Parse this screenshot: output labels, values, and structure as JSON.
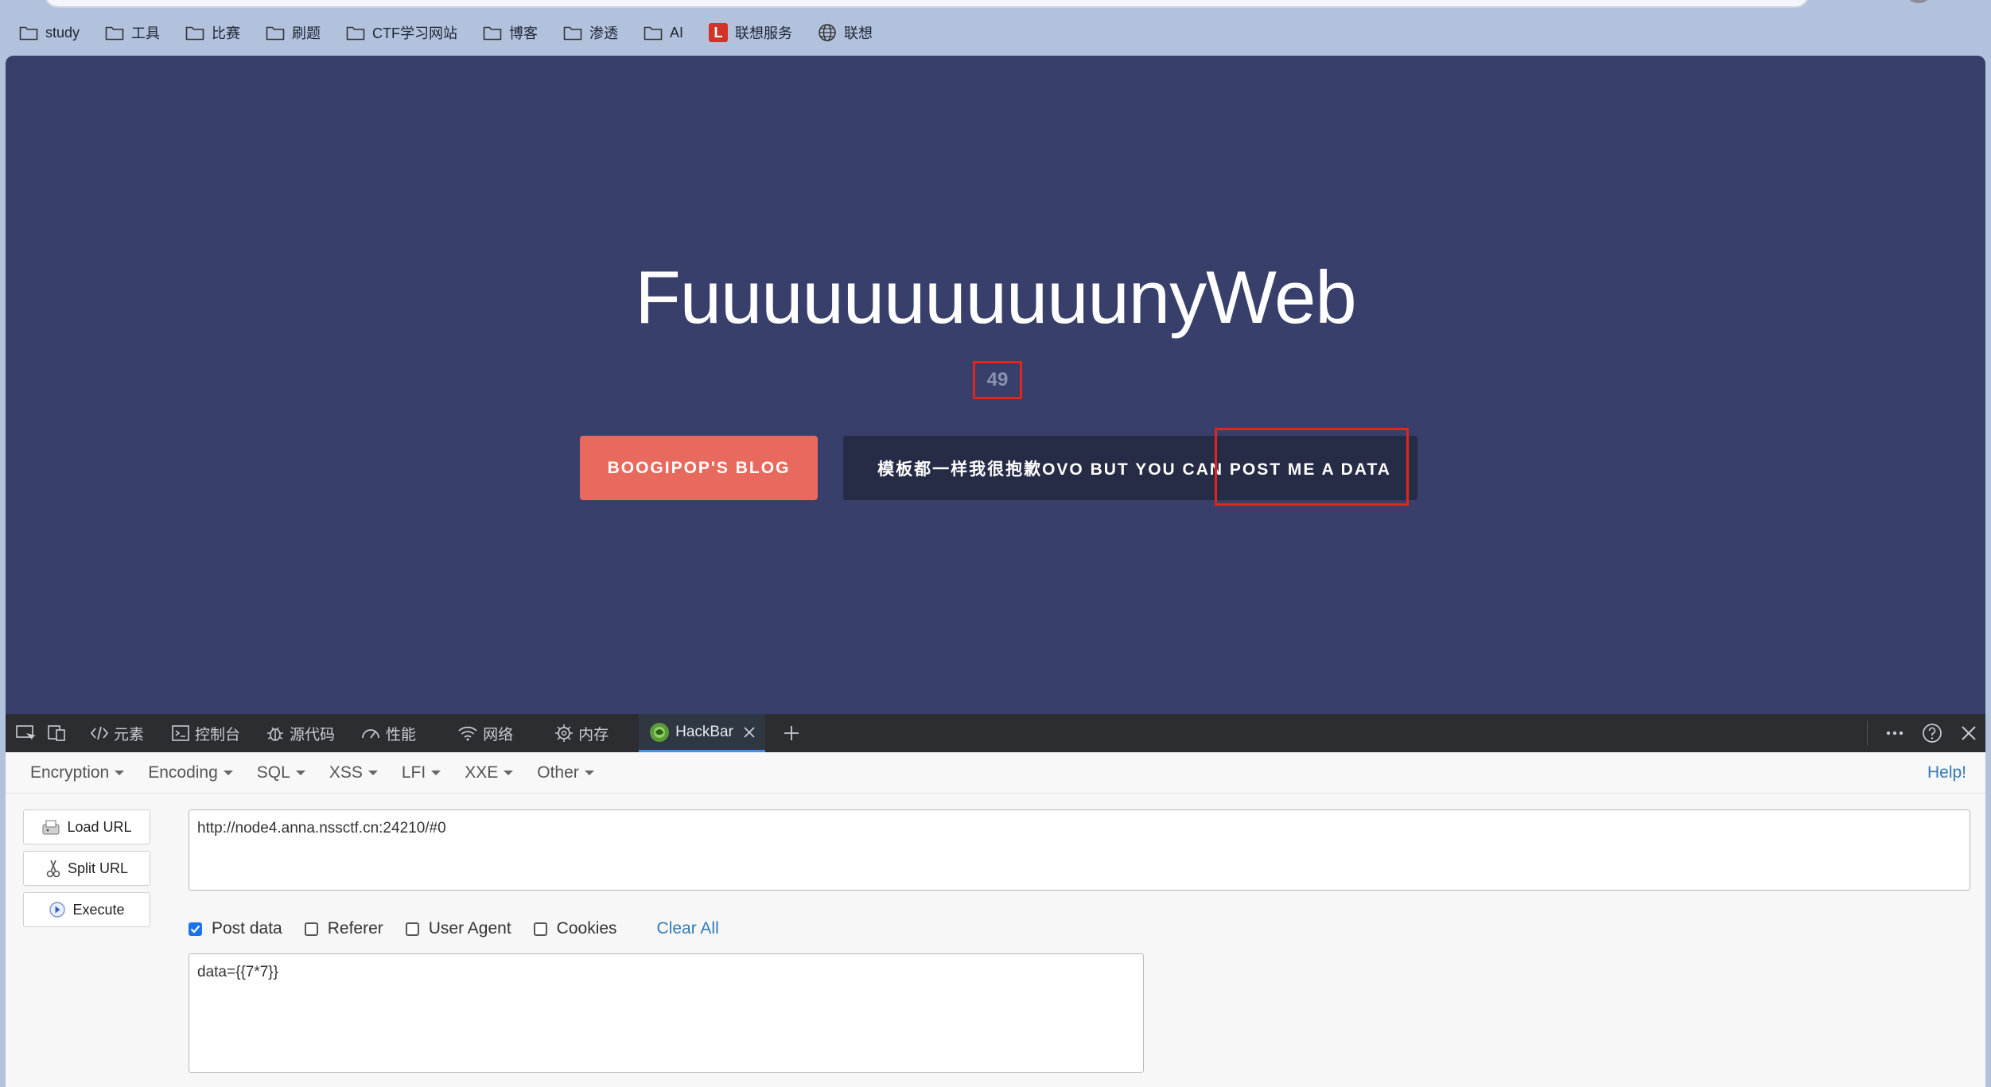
{
  "bookmarks": [
    {
      "label": "study",
      "icon": "folder-icon"
    },
    {
      "label": "工具",
      "icon": "folder-icon"
    },
    {
      "label": "比赛",
      "icon": "folder-icon"
    },
    {
      "label": "刷题",
      "icon": "folder-icon"
    },
    {
      "label": "CTF学习网站",
      "icon": "folder-icon"
    },
    {
      "label": "博客",
      "icon": "folder-icon"
    },
    {
      "label": "渗透",
      "icon": "folder-icon"
    },
    {
      "label": "AI",
      "icon": "folder-icon"
    },
    {
      "label": "联想服务",
      "icon": "lenovo-logo-icon",
      "logo_letter": "L"
    },
    {
      "label": "联想",
      "icon": "globe-icon"
    }
  ],
  "page": {
    "title": "FuuuuuuuuuuunyWeb",
    "result": "49",
    "blog_button": "BOOGIPOP'S BLOG",
    "post_button": "模板都一样我很抱歉OVO BUT YOU CAN POST ME A DATA"
  },
  "devtools": {
    "tabs": [
      {
        "label": "元素",
        "icon": "code-icon"
      },
      {
        "label": "控制台",
        "icon": "console-icon"
      },
      {
        "label": "源代码",
        "icon": "bug-icon"
      },
      {
        "label": "性能",
        "icon": "performance-icon"
      },
      {
        "label": "网络",
        "icon": "wifi-icon"
      },
      {
        "label": "内存",
        "icon": "memory-icon"
      }
    ],
    "active_tab": "HackBar"
  },
  "hackbar": {
    "menus": [
      "Encryption",
      "Encoding",
      "SQL",
      "XSS",
      "LFI",
      "XXE",
      "Other"
    ],
    "help": "Help!",
    "load_url": "Load URL",
    "split_url": "Split URL",
    "execute": "Execute",
    "url_value": "http://node4.anna.nssctf.cn:24210/#0",
    "checkboxes": [
      {
        "label": "Post data",
        "checked": true
      },
      {
        "label": "Referer",
        "checked": false
      },
      {
        "label": "User Agent",
        "checked": false
      },
      {
        "label": "Cookies",
        "checked": false
      }
    ],
    "clear_all": "Clear All",
    "post_value": "data={{7*7}}"
  },
  "colors": {
    "page_bg": "#373f6a",
    "blog_button": "#e86a5e",
    "post_button": "#262b46",
    "highlight": "#e3251c",
    "link": "#337ab7"
  }
}
